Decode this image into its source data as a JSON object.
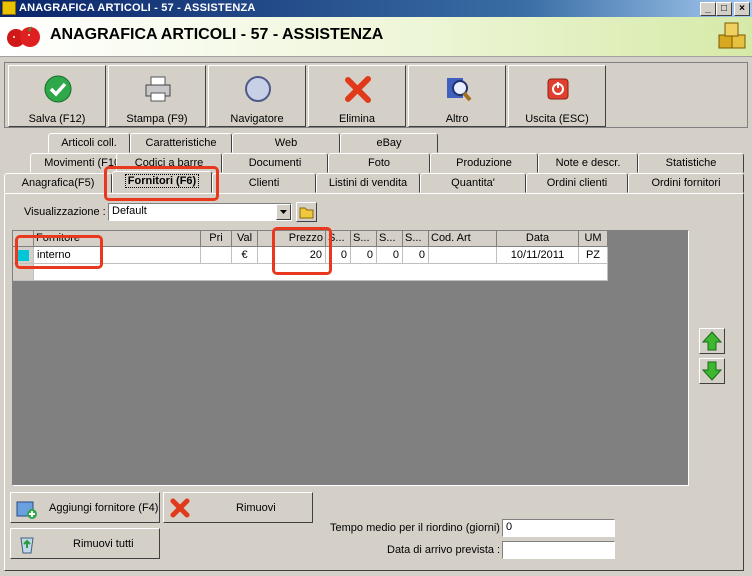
{
  "window": {
    "title": "ANAGRAFICA ARTICOLI - 57 - ASSISTENZA",
    "minimize": "_",
    "maximize": "□",
    "close": "×"
  },
  "header": {
    "title": "ANAGRAFICA ARTICOLI - 57 - ASSISTENZA"
  },
  "toolbar": [
    {
      "label": "Salva (F12)",
      "icon": "check-icon"
    },
    {
      "label": "Stampa (F9)",
      "icon": "printer-icon"
    },
    {
      "label": "Navigatore",
      "icon": "compass-icon"
    },
    {
      "label": "Elimina",
      "icon": "delete-x-icon"
    },
    {
      "label": "Altro",
      "icon": "magnifier-icon"
    },
    {
      "label": "Uscita (ESC)",
      "icon": "power-icon"
    }
  ],
  "tabs": {
    "row1": [
      "Articoli coll.",
      "Caratteristiche",
      "Web",
      "eBay"
    ],
    "row2": [
      "Movimenti (F10)",
      "Codici a barre",
      "Documenti",
      "Foto",
      "Produzione",
      "Note e descr.",
      "Statistiche"
    ],
    "row3": [
      "Anagrafica(F5)",
      "Fornitori (F6)",
      "Clienti",
      "Listini di vendita",
      "Quantita'",
      "Ordini clienti",
      "Ordini fornitori"
    ],
    "active": "Fornitori (F6)"
  },
  "view": {
    "label": "Visualizzazione :",
    "value": "Default"
  },
  "grid": {
    "columns": [
      "Fornitore",
      "Pri",
      "Val",
      "Prezzo",
      "S...",
      "S...",
      "S...",
      "S...",
      "Cod. Art",
      "Data",
      "UM"
    ],
    "rows": [
      [
        "interno",
        "",
        "€",
        "20",
        "0",
        "0",
        "0",
        "0",
        "",
        "10/11/2011",
        "PZ"
      ]
    ]
  },
  "buttons": {
    "add_supplier": "Aggiungi fornitore (F4)",
    "remove": "Rimuovi",
    "remove_all": "Rimuovi tutti"
  },
  "fields": {
    "reorder_label": "Tempo medio per il riordino (giorni) :",
    "reorder_value": "0",
    "arrival_label": "Data di arrivo prevista :",
    "arrival_value": ""
  },
  "colors": {
    "highlight": "#e8391f",
    "titlebar": "#0a246a",
    "swatch": "#00c8d8"
  }
}
